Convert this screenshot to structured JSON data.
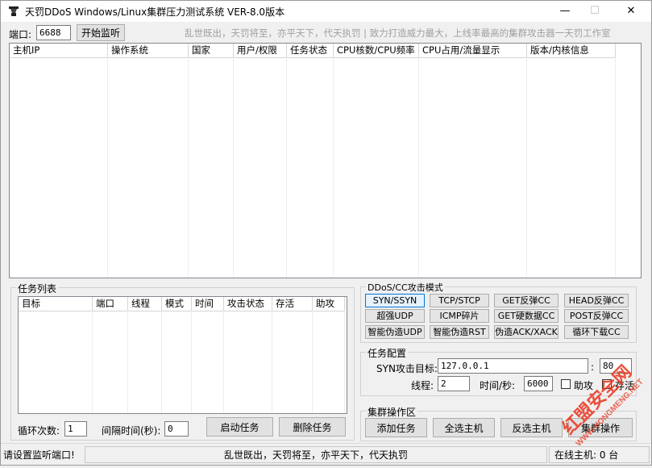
{
  "window": {
    "title": "天罚DDoS Windows/Linux集群压力测试系统 VER-8.0版本",
    "minimize": "—",
    "maximize": "☐",
    "close": "✕"
  },
  "toolbar": {
    "port_label": "端口:",
    "port_value": "6688",
    "start_listen": "开始监听",
    "slogan": "乱世既出，天罚将至，亦平天下，代天执罚 | 致力打造威力最大，上线率最高的集群攻击器一天罚工作室"
  },
  "hosts_table": {
    "columns": [
      "主机IP",
      "操作系统",
      "国家",
      "用户/权限",
      "任务状态",
      "CPU核数/CPU频率",
      "CPU占用/流量显示",
      "版本/内核信息"
    ]
  },
  "task_list": {
    "legend": "任务列表",
    "columns": [
      "目标",
      "端口",
      "线程",
      "模式",
      "时间",
      "攻击状态",
      "存活",
      "助攻"
    ],
    "loop_label": "循环次数:",
    "loop_value": "1",
    "interval_label": "间隔时间(秒):",
    "interval_value": "0",
    "start_task": "启动任务",
    "delete_task": "删除任务"
  },
  "attack_modes": {
    "legend": "DDoS/CC攻击模式",
    "buttons": [
      "SYN/SSYN",
      "TCP/STCP",
      "GET反弹CC",
      "HEAD反弹CC",
      "超强UDP",
      "ICMP碎片",
      "GET硬数据CC",
      "POST反弹CC",
      "智能伪造UDP",
      "智能伪造RST",
      "伪造ACK/XACK",
      "循环下载CC"
    ]
  },
  "task_config": {
    "legend": "任务配置",
    "target_label": "SYN攻击目标:",
    "target_value": "127.0.0.1",
    "colon": ":",
    "port_value": "80",
    "threads_label": "线程:",
    "threads_value": "2",
    "time_label": "时间/秒:",
    "time_value": "6000",
    "assist_label": "助攻",
    "alive_label": "存活"
  },
  "cluster_ops": {
    "legend": "集群操作区",
    "add_task": "添加任务",
    "select_all": "全选主机",
    "invert_select": "反选主机",
    "cluster_op": "集群操作"
  },
  "status_bar": {
    "left": "请设置监听端口!",
    "center": "乱世既出，天罚将至，亦平天下，代天执罚",
    "right": "在线主机: 0 台"
  },
  "watermark": {
    "line1": "红盟安全网",
    "line2": "WWW.HONGMENG.NET"
  },
  "colors": {
    "accent": "#e8341c",
    "window_bg": "#f0f0f0"
  }
}
